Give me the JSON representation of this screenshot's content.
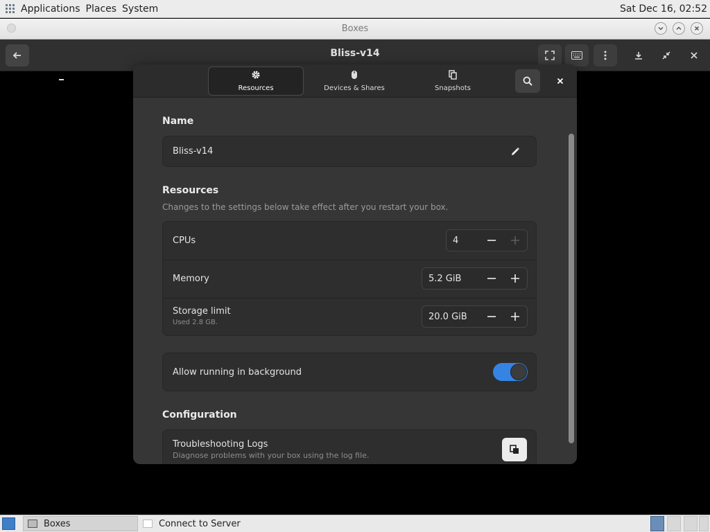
{
  "top_panel": {
    "menus": [
      "Applications",
      "Places",
      "System"
    ],
    "clock": "Sat Dec 16, 02:52"
  },
  "window": {
    "title": "Boxes",
    "controls": [
      "minimize",
      "maximize",
      "close"
    ]
  },
  "boxes_header": {
    "title": "Bliss-v14",
    "icons": {
      "back": "back-arrow-icon",
      "fullscreen": "fullscreen-icon",
      "keyboard": "keyboard-icon",
      "menu": "kebab-menu-icon",
      "download": "download-icon",
      "shrink": "shrink-icon",
      "close": "close-icon"
    }
  },
  "dialog": {
    "tabs": [
      {
        "label": "Resources",
        "icon": "gear-icon",
        "active": true
      },
      {
        "label": "Devices & Shares",
        "icon": "mouse-icon",
        "active": false
      },
      {
        "label": "Snapshots",
        "icon": "copy-icon",
        "active": false
      }
    ],
    "name_section": {
      "title": "Name",
      "value": "Bliss-v14"
    },
    "resources_section": {
      "title": "Resources",
      "subtitle": "Changes to the settings below take effect after you restart your box.",
      "rows": [
        {
          "label": "CPUs",
          "sublabel": "",
          "value": "4",
          "plus_enabled": false
        },
        {
          "label": "Memory",
          "sublabel": "",
          "value": "5.2 GiB",
          "plus_enabled": true
        },
        {
          "label": "Storage limit",
          "sublabel": "Used 2.8 GB.",
          "value": "20.0 GiB",
          "plus_enabled": true
        }
      ]
    },
    "background": {
      "label": "Allow running in background",
      "enabled": true
    },
    "configuration_section": {
      "title": "Configuration",
      "logs_label": "Troubleshooting Logs",
      "logs_sub": "Diagnose problems with your box using the log file."
    }
  },
  "taskbar": {
    "tasks": [
      "Boxes",
      "Connect to Server"
    ],
    "workspace_count": 4,
    "active_workspace": 1
  },
  "colors": {
    "accent": "#3584e4",
    "dialog_bg": "#363636",
    "header_bg": "#303030"
  }
}
